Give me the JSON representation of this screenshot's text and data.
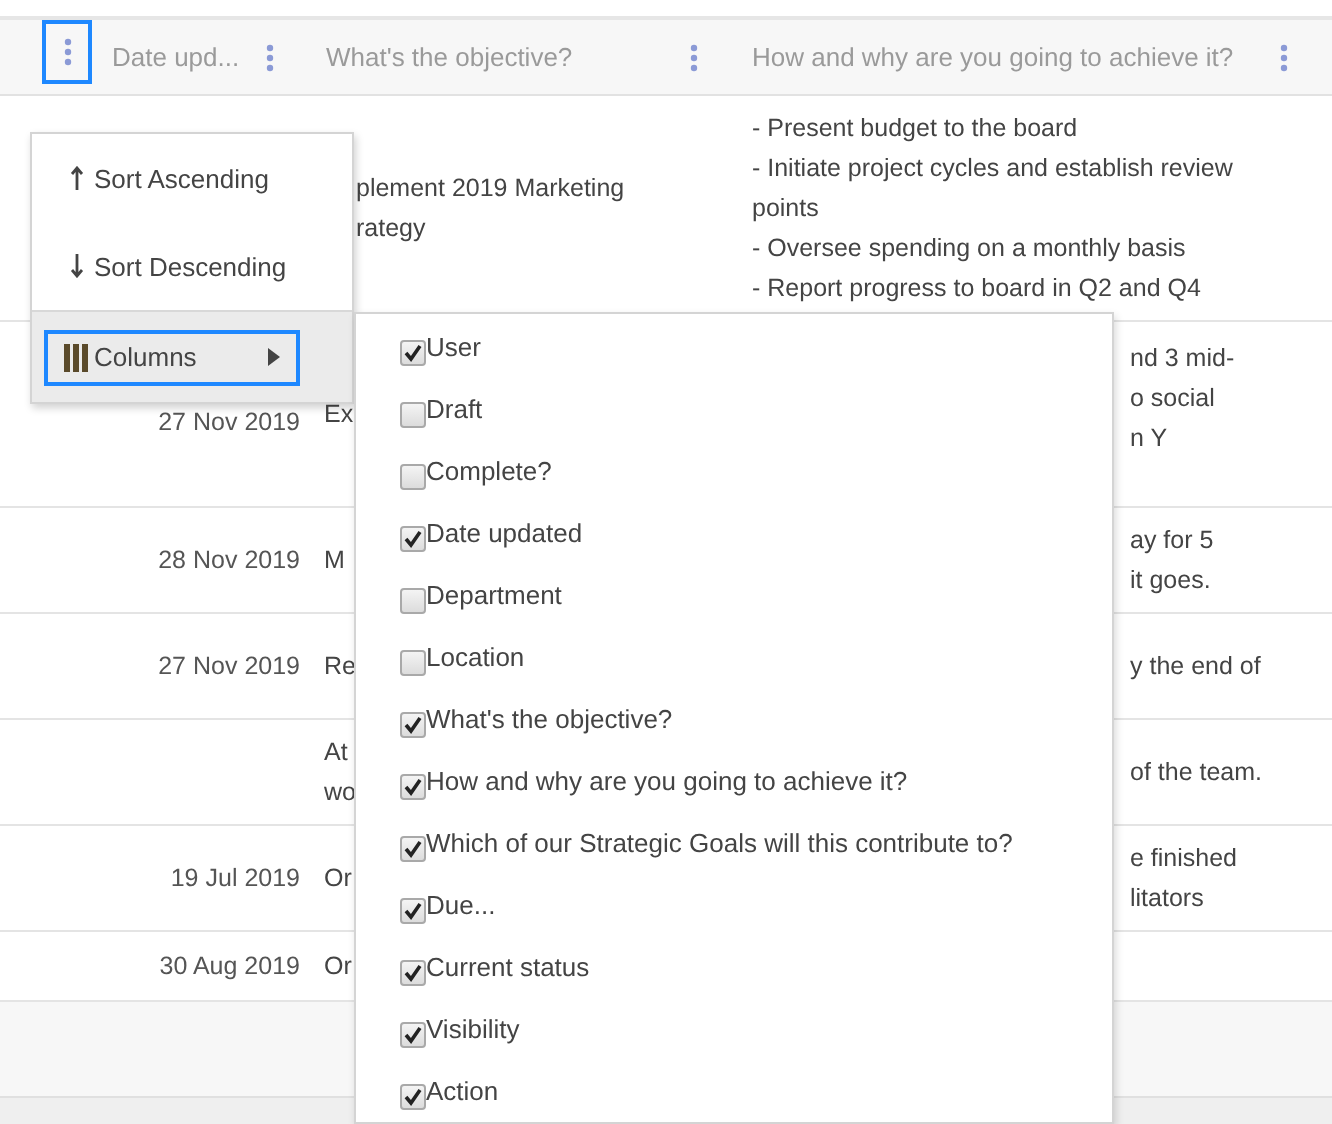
{
  "header": {
    "menu_button": {
      "selected": true
    },
    "columns": [
      {
        "label": "Date upd...",
        "selected": false
      },
      {
        "label": "What's the objective?",
        "selected": false
      },
      {
        "label": "How and why are you going to achieve it?",
        "selected": false
      }
    ]
  },
  "rows": [
    {
      "objective": [
        "plement 2019 Marketing",
        "rategy"
      ],
      "how": [
        "- Present budget to the board",
        "- Initiate project cycles and establish review points",
        "- Oversee spending on a monthly basis",
        "- Report progress to board in Q2 and Q4"
      ]
    },
    {
      "date": "27 Nov 2019",
      "objective": [
        "Ex"
      ],
      "how": [
        "nd 3 mid-",
        "o social",
        "n Y"
      ]
    },
    {
      "date": "28 Nov 2019",
      "objective": [
        "M"
      ],
      "how": [
        "ay for 5",
        "it goes."
      ]
    },
    {
      "date": "27 Nov 2019",
      "objective": [
        "Re"
      ],
      "how": [
        "y the end of"
      ]
    },
    {
      "objective": [
        "At",
        "wo"
      ],
      "how": [
        "of the team."
      ]
    },
    {
      "date": "19 Jul 2019",
      "objective": [
        "Or"
      ],
      "how": [
        "e finished",
        "litators"
      ]
    },
    {
      "date": "30 Aug 2019",
      "objective": [
        "Or"
      ]
    }
  ],
  "column_menu": {
    "items": [
      {
        "label": "Sort Ascending",
        "kind": "sort-asc",
        "selected": false
      },
      {
        "label": "Sort Descending",
        "kind": "sort-desc",
        "selected": false
      },
      {
        "label": "Columns",
        "kind": "submenu",
        "selected": true
      }
    ]
  },
  "columns_submenu": {
    "items": [
      {
        "label": "User",
        "checked": true
      },
      {
        "label": "Draft",
        "checked": false
      },
      {
        "label": "Complete?",
        "checked": false
      },
      {
        "label": "Date updated",
        "checked": true
      },
      {
        "label": "Department",
        "checked": false
      },
      {
        "label": "Location",
        "checked": false
      },
      {
        "label": "What's the objective?",
        "checked": true
      },
      {
        "label": "How and why are you going to achieve it?",
        "checked": true
      },
      {
        "label": "Which of our Strategic Goals will this contribute to?",
        "checked": true
      },
      {
        "label": "Due...",
        "checked": true
      },
      {
        "label": "Current status",
        "checked": true
      },
      {
        "label": "Visibility",
        "checked": true
      },
      {
        "label": "Action",
        "checked": true
      }
    ]
  }
}
